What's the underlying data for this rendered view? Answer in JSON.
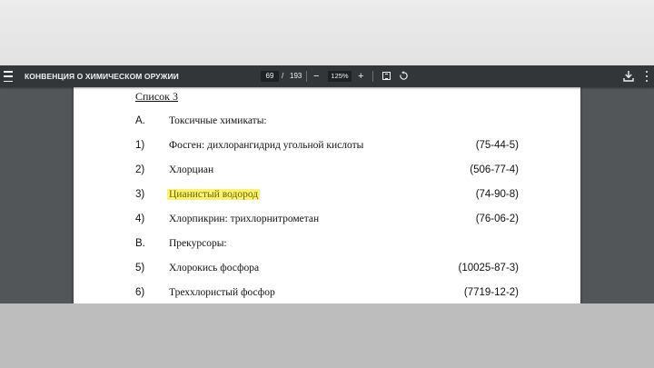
{
  "toolbar": {
    "title": "КОНВЕНЦИЯ О ХИМИЧЕСКОМ ОРУЖИИ",
    "page_current": "69",
    "page_separator": "/",
    "page_total": "193",
    "zoom_out": "−",
    "zoom_level": "125%",
    "zoom_in": "+",
    "icons": [
      "menu-icon",
      "fit-page-icon",
      "rotate-icon",
      "download-icon",
      "more-icon"
    ]
  },
  "document": {
    "schedule_title": "Список 3",
    "rows": [
      {
        "num": "A.",
        "name": "Токсичные химикаты:",
        "cas": ""
      },
      {
        "num": "1)",
        "name": "Фосген:  дихлорангидрид угольной кислоты",
        "cas": "(75-44-5)"
      },
      {
        "num": "2)",
        "name": "Хлорциан",
        "cas": "(506-77-4)"
      },
      {
        "num": "3)",
        "name": "Цианистый водород",
        "cas": "(74-90-8)",
        "highlighted": true
      },
      {
        "num": "4)",
        "name": "Хлорпикрин:  трихлорнитрометан",
        "cas": "(76-06-2)"
      },
      {
        "num": "B.",
        "name": "Прекурсоры:",
        "cas": ""
      },
      {
        "num": "5)",
        "name": "Хлорокись фосфора",
        "cas": "(10025-87-3)"
      },
      {
        "num": "6)",
        "name": "Треххлористый фосфор",
        "cas": "(7719-12-2)"
      }
    ],
    "highlight_color": "#fbf36a"
  }
}
